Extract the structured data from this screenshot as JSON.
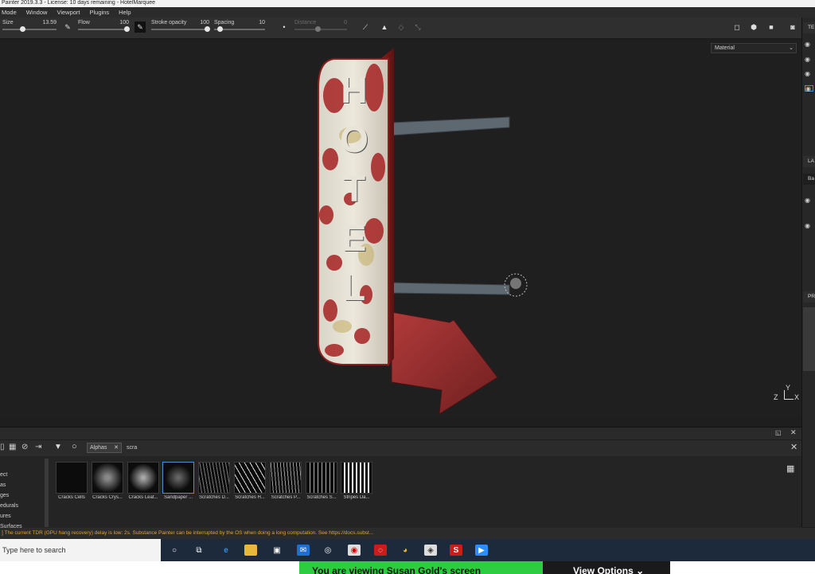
{
  "window": {
    "title": "Painter 2019.3.3 - License: 10 days remaining - HotelMarquee"
  },
  "menu": [
    "Mode",
    "Window",
    "Viewport",
    "Plugins",
    "Help"
  ],
  "toolbar": {
    "size_label": "Size",
    "size_value": "13.59",
    "flow_label": "Flow",
    "flow_value": "100",
    "opacity_label": "Stroke opacity",
    "opacity_value": "100",
    "spacing_label": "Spacing",
    "spacing_value": "10",
    "distance_label": "Distance",
    "distance_value": "0"
  },
  "viewport": {
    "material_select": "Material",
    "sign_letters": [
      "H",
      "O",
      "T",
      "E",
      "L"
    ],
    "axis_z": "Z",
    "axis_y": "Y",
    "axis_x": "X"
  },
  "right_panel": {
    "hdr1": "TE",
    "hdr2": "LA",
    "hdr2_sub": "Ba",
    "hdr3": "PR"
  },
  "shelf": {
    "filter_tag": "Alphas",
    "search_value": "scra",
    "categories": [
      "ect",
      "as",
      "ges",
      "edurals",
      "ures",
      "Surfaces"
    ],
    "items": [
      {
        "label": "Cracks Cells"
      },
      {
        "label": "Cracks Crys..."
      },
      {
        "label": "Cracks Leat..."
      },
      {
        "label": "Sandpaper ..."
      },
      {
        "label": "Scratches D..."
      },
      {
        "label": "Scratches H..."
      },
      {
        "label": "Scratches P..."
      },
      {
        "label": "Scratches S..."
      },
      {
        "label": "Stripes Da..."
      }
    ],
    "selected_index": 3
  },
  "status": {
    "text": "] The current TDR (GPU hang recovery) delay is low: 2s. Substance Painter can be interrupted by the OS when doing a long computation. See https://docs.subst..."
  },
  "taskbar": {
    "search_placeholder": "Type here to search"
  },
  "zoom": {
    "banner": "You are viewing Susan Gold's screen",
    "options": "View Options"
  },
  "colors": {
    "accent_blue": "#4f8fd1",
    "status_orange": "#e1a23a",
    "zoom_green": "#2ecc40",
    "rust_red": "#a52a2a"
  }
}
